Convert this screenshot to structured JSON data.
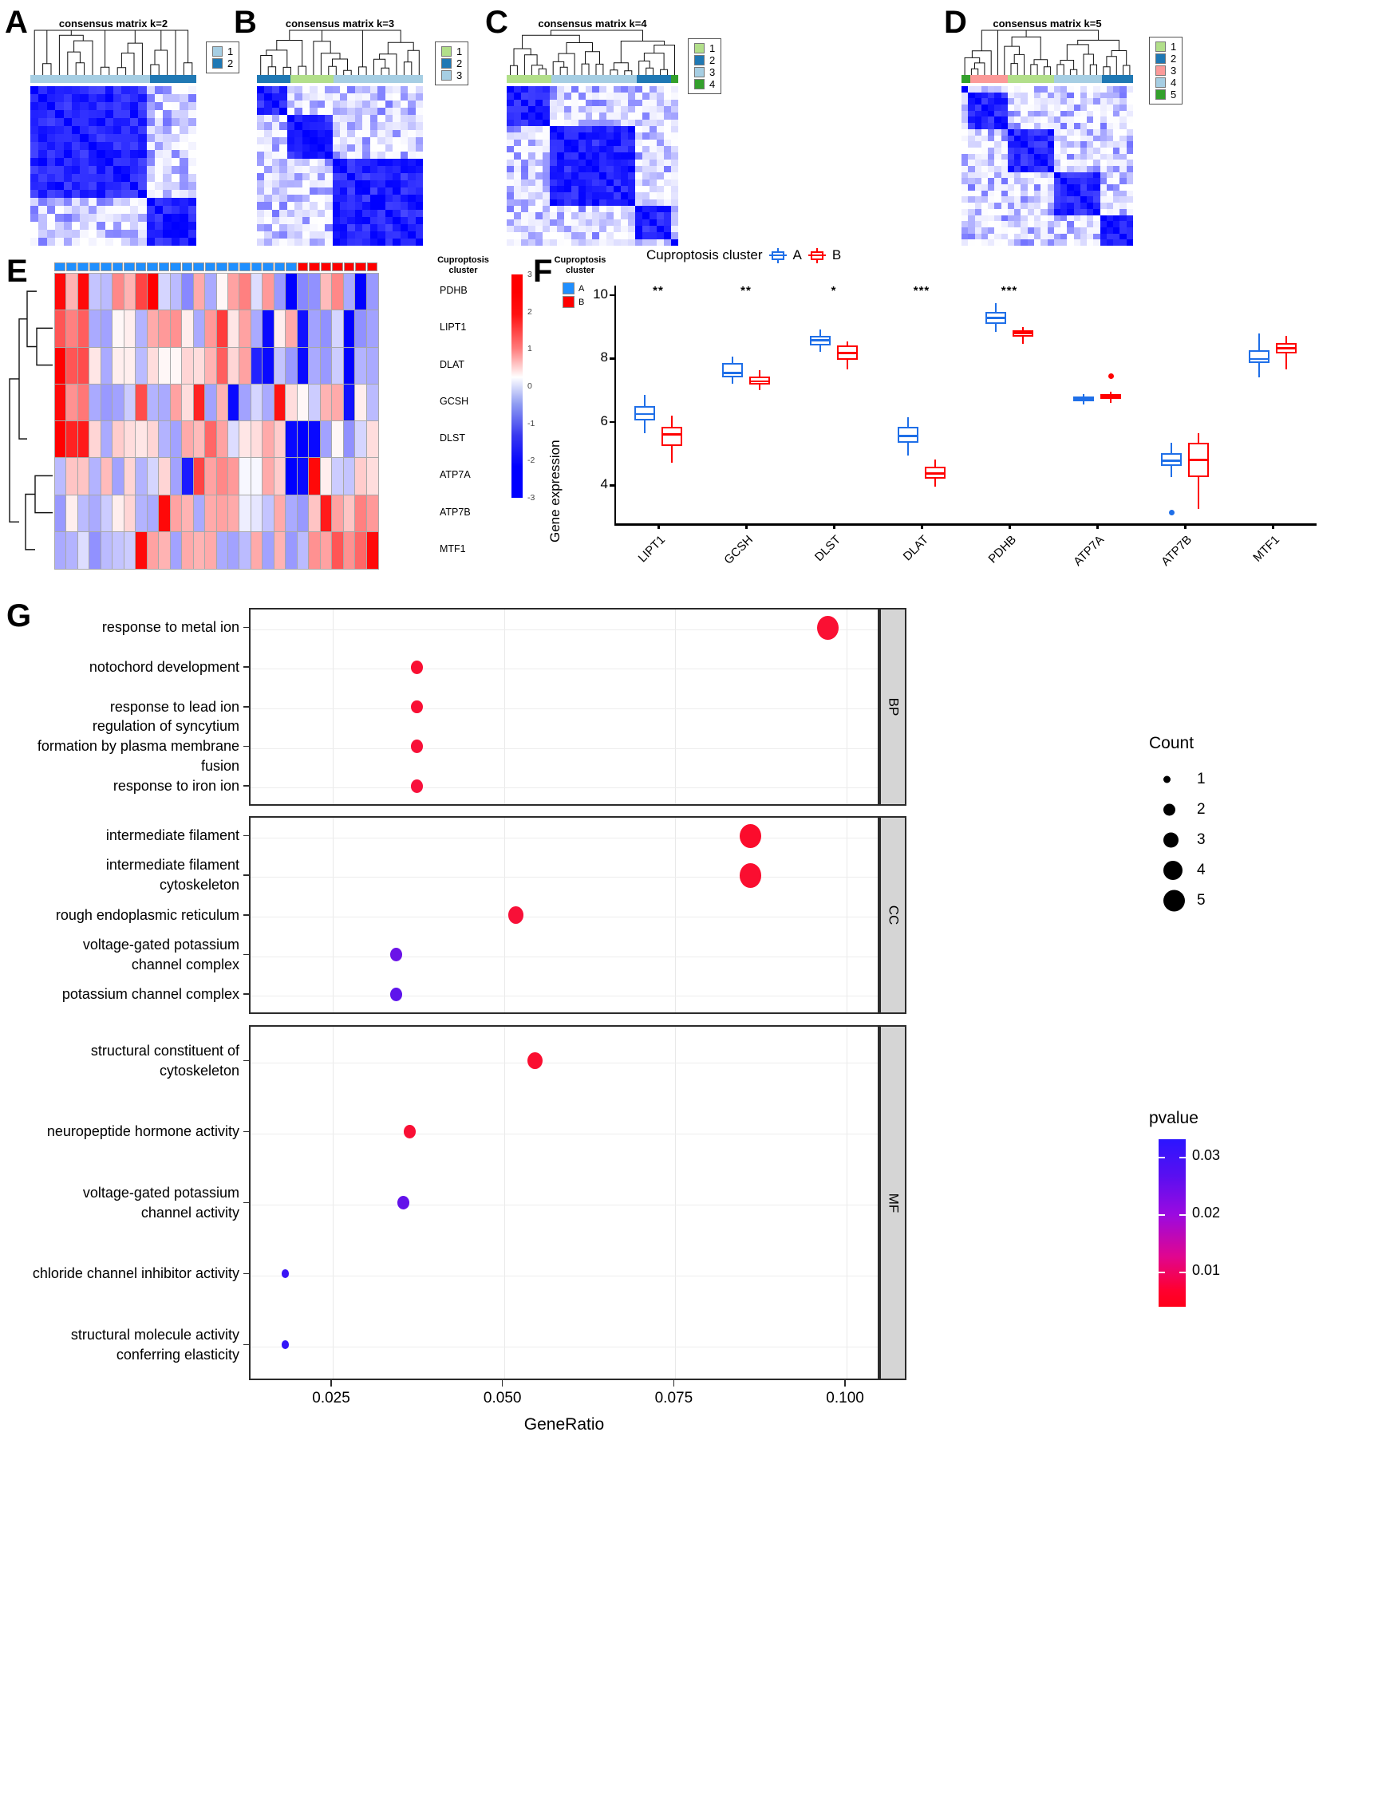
{
  "panels": {
    "A": {
      "letter": "A",
      "title": "consensus matrix k=2",
      "legend_items": [
        {
          "label": "1",
          "color": "#a6cee3"
        },
        {
          "label": "2",
          "color": "#1f78b4"
        }
      ]
    },
    "B": {
      "letter": "B",
      "title": "consensus matrix k=3",
      "legend_items": [
        {
          "label": "1",
          "color": "#b2df8a"
        },
        {
          "label": "2",
          "color": "#1f78b4"
        },
        {
          "label": "3",
          "color": "#a6cee3"
        }
      ]
    },
    "C": {
      "letter": "C",
      "title": "consensus matrix k=4",
      "legend_items": [
        {
          "label": "1",
          "color": "#b2df8a"
        },
        {
          "label": "2",
          "color": "#1f78b4"
        },
        {
          "label": "3",
          "color": "#a6cee3"
        },
        {
          "label": "4",
          "color": "#33a02c"
        }
      ]
    },
    "D": {
      "letter": "D",
      "title": "consensus matrix k=5",
      "legend_items": [
        {
          "label": "1",
          "color": "#b2df8a"
        },
        {
          "label": "2",
          "color": "#1f78b4"
        },
        {
          "label": "3",
          "color": "#fb9a99"
        },
        {
          "label": "4",
          "color": "#a6cee3"
        },
        {
          "label": "5",
          "color": "#33a02c"
        }
      ]
    },
    "E": {
      "letter": "E",
      "genes": [
        "PDHB",
        "LIPT1",
        "DLAT",
        "GCSH",
        "DLST",
        "ATP7A",
        "ATP7B",
        "MTF1"
      ],
      "annotation_title": "Cuproptosis cluster",
      "scale_title": "Cuproptosis cluster",
      "scale_ticks": [
        "3",
        "2",
        "1",
        "0",
        "-1",
        "-2",
        "-3"
      ],
      "cluster_legend": [
        {
          "label": "A",
          "color": "#1f8fff"
        },
        {
          "label": "B",
          "color": "#ff0000"
        }
      ]
    },
    "F": {
      "letter": "F",
      "legend_title": "Cuproptosis cluster",
      "legend_items": [
        {
          "label": "A",
          "color": "#1f6fe8"
        },
        {
          "label": "B",
          "color": "#ff0000"
        }
      ],
      "ylabel": "Gene expression"
    },
    "G": {
      "letter": "G",
      "xtitle": "GeneRatio",
      "count_title": "Count",
      "count_values": [
        "1",
        "2",
        "3",
        "4",
        "5"
      ],
      "pvalue_title": "pvalue",
      "pvalue_ticks": [
        "0.03",
        "0.02",
        "0.01"
      ],
      "facets": [
        "BP",
        "CC",
        "MF"
      ]
    }
  },
  "chart_data": [
    {
      "type": "heatmap",
      "title": "consensus matrix k=2",
      "panel": "A",
      "clusters": [
        {
          "id": "1",
          "color": "#a6cee3",
          "fraction": 0.72
        },
        {
          "id": "2",
          "color": "#1f78b4",
          "fraction": 0.28
        }
      ]
    },
    {
      "type": "heatmap",
      "title": "consensus matrix k=3",
      "panel": "B",
      "clusters": [
        {
          "id": "2",
          "color": "#1f78b4",
          "fraction": 0.2
        },
        {
          "id": "1",
          "color": "#b2df8a",
          "fraction": 0.26
        },
        {
          "id": "3",
          "color": "#a6cee3",
          "fraction": 0.54
        }
      ]
    },
    {
      "type": "heatmap",
      "title": "consensus matrix k=4",
      "panel": "C",
      "clusters": [
        {
          "id": "1",
          "color": "#b2df8a",
          "fraction": 0.26
        },
        {
          "id": "3",
          "color": "#a6cee3",
          "fraction": 0.5
        },
        {
          "id": "2",
          "color": "#1f78b4",
          "fraction": 0.2
        },
        {
          "id": "4",
          "color": "#33a02c",
          "fraction": 0.04
        }
      ]
    },
    {
      "type": "heatmap",
      "title": "consensus matrix k=5",
      "panel": "D",
      "clusters": [
        {
          "id": "5",
          "color": "#33a02c",
          "fraction": 0.05
        },
        {
          "id": "3",
          "color": "#fb9a99",
          "fraction": 0.22
        },
        {
          "id": "1",
          "color": "#b2df8a",
          "fraction": 0.27
        },
        {
          "id": "4",
          "color": "#a6cee3",
          "fraction": 0.28
        },
        {
          "id": "2",
          "color": "#1f78b4",
          "fraction": 0.18
        }
      ]
    },
    {
      "type": "heatmap",
      "panel": "E",
      "title": "Cuproptosis gene expression heatmap",
      "rows": [
        "PDHB",
        "LIPT1",
        "DLAT",
        "GCSH",
        "DLST",
        "ATP7A",
        "ATP7B",
        "MTF1"
      ],
      "n_columns": 28,
      "zlim": [
        -3,
        3
      ],
      "column_annotation": {
        "name": "Cuproptosis cluster",
        "A_count": 21,
        "B_count": 7
      },
      "values": [
        [
          2.9,
          0.9,
          2.9,
          -0.7,
          -0.8,
          1.4,
          0.9,
          2.2,
          3.0,
          -0.5,
          -0.8,
          -1.4,
          1.0,
          -1.0,
          0.1,
          1.1,
          1.5,
          -0.4,
          1.2,
          -1.2,
          -3.0,
          -1.4,
          -1.3,
          0.8,
          1.4,
          -1.0,
          -3.0,
          -1.2
        ],
        [
          2.0,
          1.5,
          1.9,
          -1.0,
          -1.1,
          0.1,
          0.2,
          -0.9,
          1.0,
          1.2,
          1.3,
          0.2,
          -1.0,
          1.2,
          2.3,
          0.3,
          1.1,
          -1.0,
          -2.9,
          0.2,
          1.0,
          -2.8,
          -1.1,
          -1.3,
          -0.5,
          -3.0,
          -1.3,
          -1.1
        ],
        [
          3.0,
          2.0,
          2.1,
          0.3,
          -1.0,
          0.2,
          0.2,
          -0.8,
          0.4,
          0.1,
          0.1,
          0.5,
          0.4,
          0.9,
          1.9,
          0.5,
          1.1,
          -2.6,
          -2.9,
          -0.7,
          -1.2,
          -2.9,
          -1.0,
          -1.2,
          -0.6,
          -3.0,
          -0.9,
          -1.0
        ],
        [
          2.9,
          1.3,
          1.6,
          -1.0,
          -1.2,
          -1.1,
          -0.6,
          2.1,
          -0.9,
          -1.0,
          1.1,
          0.4,
          2.6,
          -1.1,
          0.9,
          -2.9,
          -1.1,
          -0.5,
          -1.0,
          2.8,
          0.4,
          0.1,
          -0.6,
          0.9,
          1.0,
          -2.8,
          0.2,
          -0.8
        ],
        [
          3.0,
          2.6,
          2.7,
          0.5,
          -1.0,
          0.6,
          0.4,
          0.3,
          0.5,
          -0.9,
          -1.1,
          1.0,
          0.8,
          1.8,
          1.1,
          -0.4,
          0.3,
          0.4,
          1.0,
          0.6,
          -2.9,
          -3.0,
          -2.9,
          -1.1,
          0.1,
          -1.3,
          -0.5,
          0.4
        ],
        [
          -0.8,
          0.7,
          0.7,
          -0.9,
          0.8,
          -1.1,
          0.5,
          -0.9,
          -0.5,
          0.5,
          -1.1,
          -2.7,
          2.2,
          1.1,
          1.4,
          1.2,
          -0.1,
          -0.1,
          1.0,
          0.6,
          -3.0,
          -2.9,
          2.9,
          0.2,
          -0.6,
          -0.7,
          0.6,
          0.4
        ],
        [
          -1.2,
          0.2,
          -0.8,
          -1.0,
          -0.6,
          0.2,
          0.5,
          -0.9,
          -1.0,
          2.9,
          1.1,
          0.9,
          -1.0,
          1.0,
          1.1,
          1.0,
          -0.2,
          -0.3,
          -0.7,
          1.0,
          -1.0,
          -1.2,
          0.7,
          2.7,
          1.1,
          0.7,
          1.5,
          1.2
        ],
        [
          -1.0,
          -0.9,
          -0.4,
          -1.3,
          -0.8,
          -0.7,
          -0.6,
          2.9,
          1.1,
          0.9,
          -1.1,
          1.0,
          0.9,
          1.0,
          -1.0,
          -1.1,
          -0.8,
          1.0,
          -1.1,
          0.9,
          -1.2,
          -0.8,
          1.3,
          1.1,
          2.0,
          1.3,
          1.8,
          2.9
        ]
      ]
    },
    {
      "type": "box",
      "panel": "F",
      "title": "Gene expression by cuproptosis cluster",
      "xlabel": "",
      "ylabel": "Gene expression",
      "categories": [
        "LIPT1",
        "GCSH",
        "DLST",
        "DLAT",
        "PDHB",
        "ATP7A",
        "ATP7B",
        "MTF1"
      ],
      "ylim": [
        2.8,
        10.3
      ],
      "yticks": [
        4,
        6,
        8,
        10
      ],
      "legend": [
        "A",
        "B"
      ],
      "significance": [
        "**",
        "**",
        "*",
        "***",
        "***",
        "",
        "",
        ""
      ],
      "series": [
        {
          "name": "A",
          "color": "#1f6fe8",
          "boxes": [
            {
              "min": 5.65,
              "q1": 6.05,
              "med": 6.25,
              "q3": 6.5,
              "max": 6.85,
              "outliers": []
            },
            {
              "min": 7.2,
              "q1": 7.4,
              "med": 7.55,
              "q3": 7.85,
              "max": 8.05,
              "outliers": []
            },
            {
              "min": 8.2,
              "q1": 8.42,
              "med": 8.58,
              "q3": 8.72,
              "max": 8.92,
              "outliers": []
            },
            {
              "min": 4.95,
              "q1": 5.35,
              "med": 5.55,
              "q3": 5.85,
              "max": 6.15,
              "outliers": []
            },
            {
              "min": 8.85,
              "q1": 9.1,
              "med": 9.28,
              "q3": 9.48,
              "max": 9.75,
              "outliers": []
            },
            {
              "min": 6.55,
              "q1": 6.65,
              "med": 6.72,
              "q3": 6.8,
              "max": 6.88,
              "outliers": []
            },
            {
              "min": 4.25,
              "q1": 4.6,
              "med": 4.78,
              "q3": 5.02,
              "max": 5.35,
              "outliers": [
                3.15
              ]
            },
            {
              "min": 7.4,
              "q1": 7.85,
              "med": 7.98,
              "q3": 8.25,
              "max": 8.8,
              "outliers": []
            }
          ]
        },
        {
          "name": "B",
          "color": "#ff0000",
          "boxes": [
            {
              "min": 4.7,
              "q1": 5.25,
              "med": 5.6,
              "q3": 5.85,
              "max": 6.2,
              "outliers": []
            },
            {
              "min": 7.0,
              "q1": 7.18,
              "med": 7.28,
              "q3": 7.42,
              "max": 7.62,
              "outliers": []
            },
            {
              "min": 7.65,
              "q1": 7.95,
              "med": 8.18,
              "q3": 8.42,
              "max": 8.55,
              "outliers": []
            },
            {
              "min": 3.95,
              "q1": 4.2,
              "med": 4.38,
              "q3": 4.58,
              "max": 4.82,
              "outliers": []
            },
            {
              "min": 8.45,
              "q1": 8.7,
              "med": 8.8,
              "q3": 8.9,
              "max": 8.98,
              "outliers": []
            },
            {
              "min": 6.6,
              "q1": 6.72,
              "med": 6.8,
              "q3": 6.88,
              "max": 6.95,
              "outliers": [
                7.45
              ]
            },
            {
              "min": 3.25,
              "q1": 4.25,
              "med": 4.8,
              "q3": 5.35,
              "max": 5.65,
              "outliers": []
            },
            {
              "min": 7.65,
              "q1": 8.15,
              "med": 8.32,
              "q3": 8.48,
              "max": 8.72,
              "outliers": []
            }
          ]
        }
      ]
    },
    {
      "type": "scatter",
      "panel": "G",
      "title": "GO enrichment dot plot",
      "xlabel": "GeneRatio",
      "ylabel": "",
      "xlim": [
        0.013,
        0.105
      ],
      "xticks": [
        0.025,
        0.05,
        0.075,
        0.1
      ],
      "xticklabels": [
        "0.025",
        "0.050",
        "0.075",
        "0.100"
      ],
      "size_legend": {
        "title": "Count",
        "values": [
          1,
          2,
          3,
          4,
          5
        ]
      },
      "color_legend": {
        "title": "pvalue",
        "ticks": [
          0.03,
          0.02,
          0.01
        ],
        "low_color": "#ff0018",
        "high_color": "#2b15ff"
      },
      "facets": [
        {
          "name": "BP",
          "points": [
            {
              "term": "response to metal ion",
              "generatio": 0.0975,
              "count": 5,
              "pvalue": 0.004,
              "color": "#fa1033"
            },
            {
              "term": "notochord development",
              "generatio": 0.0375,
              "count": 2,
              "pvalue": 0.004,
              "color": "#f90f32"
            },
            {
              "term": "response to lead ion",
              "generatio": 0.0375,
              "count": 2,
              "pvalue": 0.005,
              "color": "#f90f34"
            },
            {
              "term": "regulation of syncytium formation by plasma membrane fusion",
              "generatio": 0.0375,
              "count": 2,
              "pvalue": 0.006,
              "color": "#f81038"
            },
            {
              "term": "response to iron ion",
              "generatio": 0.0375,
              "count": 2,
              "pvalue": 0.007,
              "color": "#f8113c"
            }
          ]
        },
        {
          "name": "CC",
          "points": [
            {
              "term": "intermediate filament",
              "generatio": 0.0862,
              "count": 5,
              "pvalue": 0.003,
              "color": "#fb0c2c"
            },
            {
              "term": "intermediate filament cytoskeleton",
              "generatio": 0.0862,
              "count": 5,
              "pvalue": 0.004,
              "color": "#fa0e30"
            },
            {
              "term": "rough endoplasmic reticulum",
              "generatio": 0.052,
              "count": 3,
              "pvalue": 0.006,
              "color": "#f81038"
            },
            {
              "term": "voltage-gated potassium channel complex",
              "generatio": 0.0345,
              "count": 2,
              "pvalue": 0.024,
              "color": "#6b13e8"
            },
            {
              "term": "potassium channel complex",
              "generatio": 0.0345,
              "count": 2,
              "pvalue": 0.026,
              "color": "#5e14ec"
            }
          ]
        },
        {
          "name": "MF",
          "points": [
            {
              "term": "structural constituent of cytoskeleton",
              "generatio": 0.0548,
              "count": 3,
              "pvalue": 0.005,
              "color": "#fa0e30"
            },
            {
              "term": "neuropeptide hormone activity",
              "generatio": 0.0365,
              "count": 2,
              "pvalue": 0.006,
              "color": "#f90f34"
            },
            {
              "term": "voltage-gated potassium channel activity",
              "generatio": 0.0355,
              "count": 2,
              "pvalue": 0.025,
              "color": "#6312ea"
            },
            {
              "term": "chloride channel inhibitor activity",
              "generatio": 0.0183,
              "count": 1,
              "pvalue": 0.031,
              "color": "#3a15f6"
            },
            {
              "term": "structural molecule activity conferring elasticity",
              "generatio": 0.0183,
              "count": 1,
              "pvalue": 0.032,
              "color": "#3315f8"
            }
          ]
        }
      ]
    }
  ]
}
